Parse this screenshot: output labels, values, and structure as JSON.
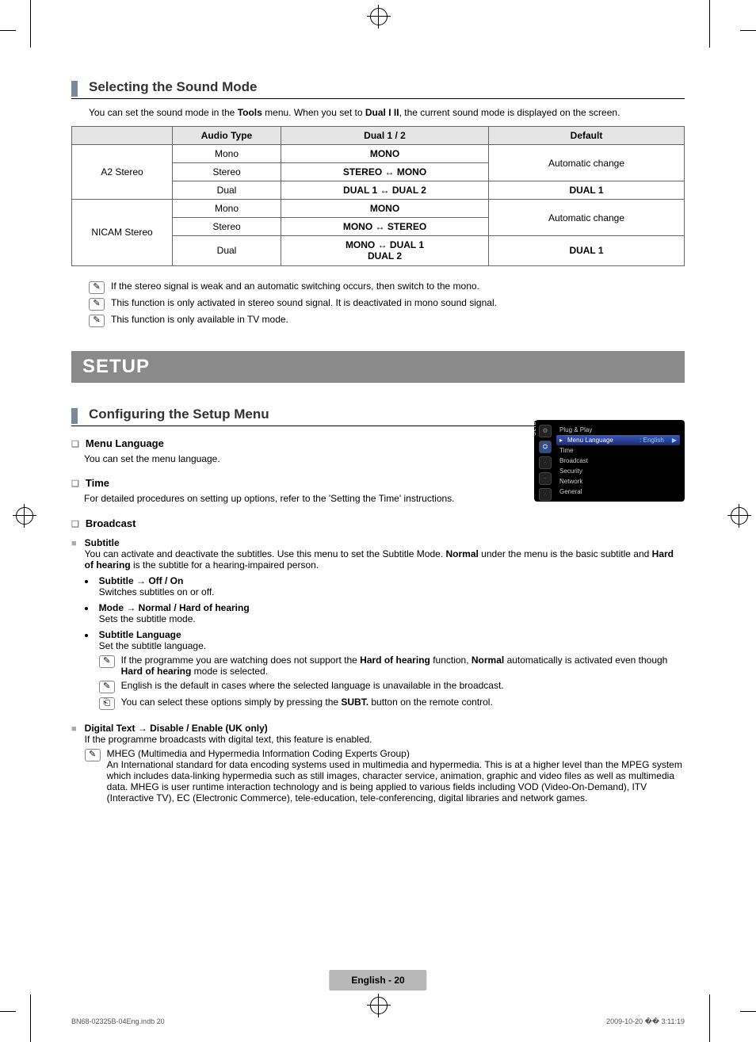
{
  "section1": {
    "title": "Selecting the Sound Mode",
    "intro_prefix": "You can set the sound mode in the ",
    "intro_bold1": "Tools",
    "intro_mid": " menu. When you set to ",
    "intro_bold2": "Dual I II",
    "intro_suffix": ", the current sound mode is displayed on the screen."
  },
  "table": {
    "headers": {
      "h0": "",
      "h1": "Audio Type",
      "h2": "Dual 1 / 2",
      "h3": "Default"
    },
    "a2": {
      "label": "A2 Stereo",
      "r1": {
        "at": "Mono",
        "d12": "MONO",
        "def": "Automatic change"
      },
      "r2": {
        "at": "Stereo",
        "d12": "STEREO ↔ MONO"
      },
      "r3": {
        "at": "Dual",
        "d12": "DUAL 1 ↔ DUAL 2",
        "def": "DUAL 1"
      }
    },
    "nicam": {
      "label": "NICAM Stereo",
      "r1": {
        "at": "Mono",
        "d12": "MONO",
        "def": "Automatic change"
      },
      "r2": {
        "at": "Stereo",
        "d12": "MONO ↔ STEREO"
      },
      "r3": {
        "at": "Dual",
        "d12a": "MONO ↔ DUAL 1",
        "d12b": "DUAL 2",
        "def": "DUAL 1"
      }
    }
  },
  "notes": {
    "n1": "If the stereo signal is weak and an automatic switching occurs, then switch to the mono.",
    "n2": "This function is only activated in stereo sound signal. It is deactivated in mono sound signal.",
    "n3": "This function is only available in TV mode."
  },
  "setup": {
    "bar": "SETUP",
    "title": "Configuring the Setup Menu",
    "menu_lang": {
      "h": "Menu Language",
      "body": "You can set the menu language."
    },
    "time": {
      "h": "Time",
      "body": "For detailed procedures on setting up options, refer to the 'Setting the Time' instructions."
    },
    "broadcast": {
      "h": "Broadcast",
      "subtitle": {
        "h": "Subtitle",
        "body_pre": "You can activate and deactivate the subtitles. Use this menu to set the Subtitle Mode. ",
        "body_b1": "Normal",
        "body_mid": " under the menu is the basic subtitle and ",
        "body_b2": "Hard of hearing",
        "body_post": " is the subtitle for a hearing-impaired person.",
        "b1": {
          "h": "Subtitle → Off / On",
          "d": "Switches subtitles on or off."
        },
        "b2": {
          "h": "Mode → Normal / Hard of hearing",
          "d": "Sets the subtitle mode."
        },
        "b3": {
          "h": "Subtitle Language",
          "d": "Set the subtitle language.",
          "n1_pre": "If the programme you are watching does not support the ",
          "n1_b1": "Hard of hearing",
          "n1_mid": " function, ",
          "n1_b2": "Normal",
          "n1_mid2": " automatically is activated even though ",
          "n1_b3": "Hard of hearing",
          "n1_post": " mode is selected.",
          "n2": "English is the default in cases where the selected language is unavailable in the broadcast.",
          "n3_pre": "You can select these options simply by pressing the ",
          "n3_b": "SUBT.",
          "n3_post": " button on the remote control."
        }
      },
      "digital_text": {
        "h": "Digital Text → Disable / Enable (UK only)",
        "body": "If the programme broadcasts with digital text, this feature is enabled.",
        "n1": "MHEG (Multimedia and Hypermedia Information Coding Experts Group)",
        "n1_body": "An International standard for data encoding systems used in multimedia and hypermedia. This is at a higher level than the MPEG system which includes data-linking hypermedia such as still images, character service, animation, graphic and video files as well as multimedia data. MHEG is user runtime interaction technology and is being applied to various fields including VOD (Video-On-Demand), ITV (Interactive TV), EC (Electronic Commerce), tele-education, tele-conferencing, digital libraries and network games."
      }
    }
  },
  "tvmenu": {
    "side": "Setup",
    "items": {
      "i0": "Plug & Play",
      "i1": "Menu Language",
      "i1_val": ": English",
      "i2": "Time",
      "i3": "Broadcast",
      "i4": "Security",
      "i5": "Network",
      "i6": "General"
    }
  },
  "footer": {
    "page": "English - 20",
    "left": "BN68-02325B-04Eng.indb   20",
    "right": "2009-10-20   �� 3:11:19"
  },
  "glyphs": {
    "note": "✎",
    "remote": "⎗",
    "square": "❏",
    "box": "■",
    "bullet": "●"
  }
}
